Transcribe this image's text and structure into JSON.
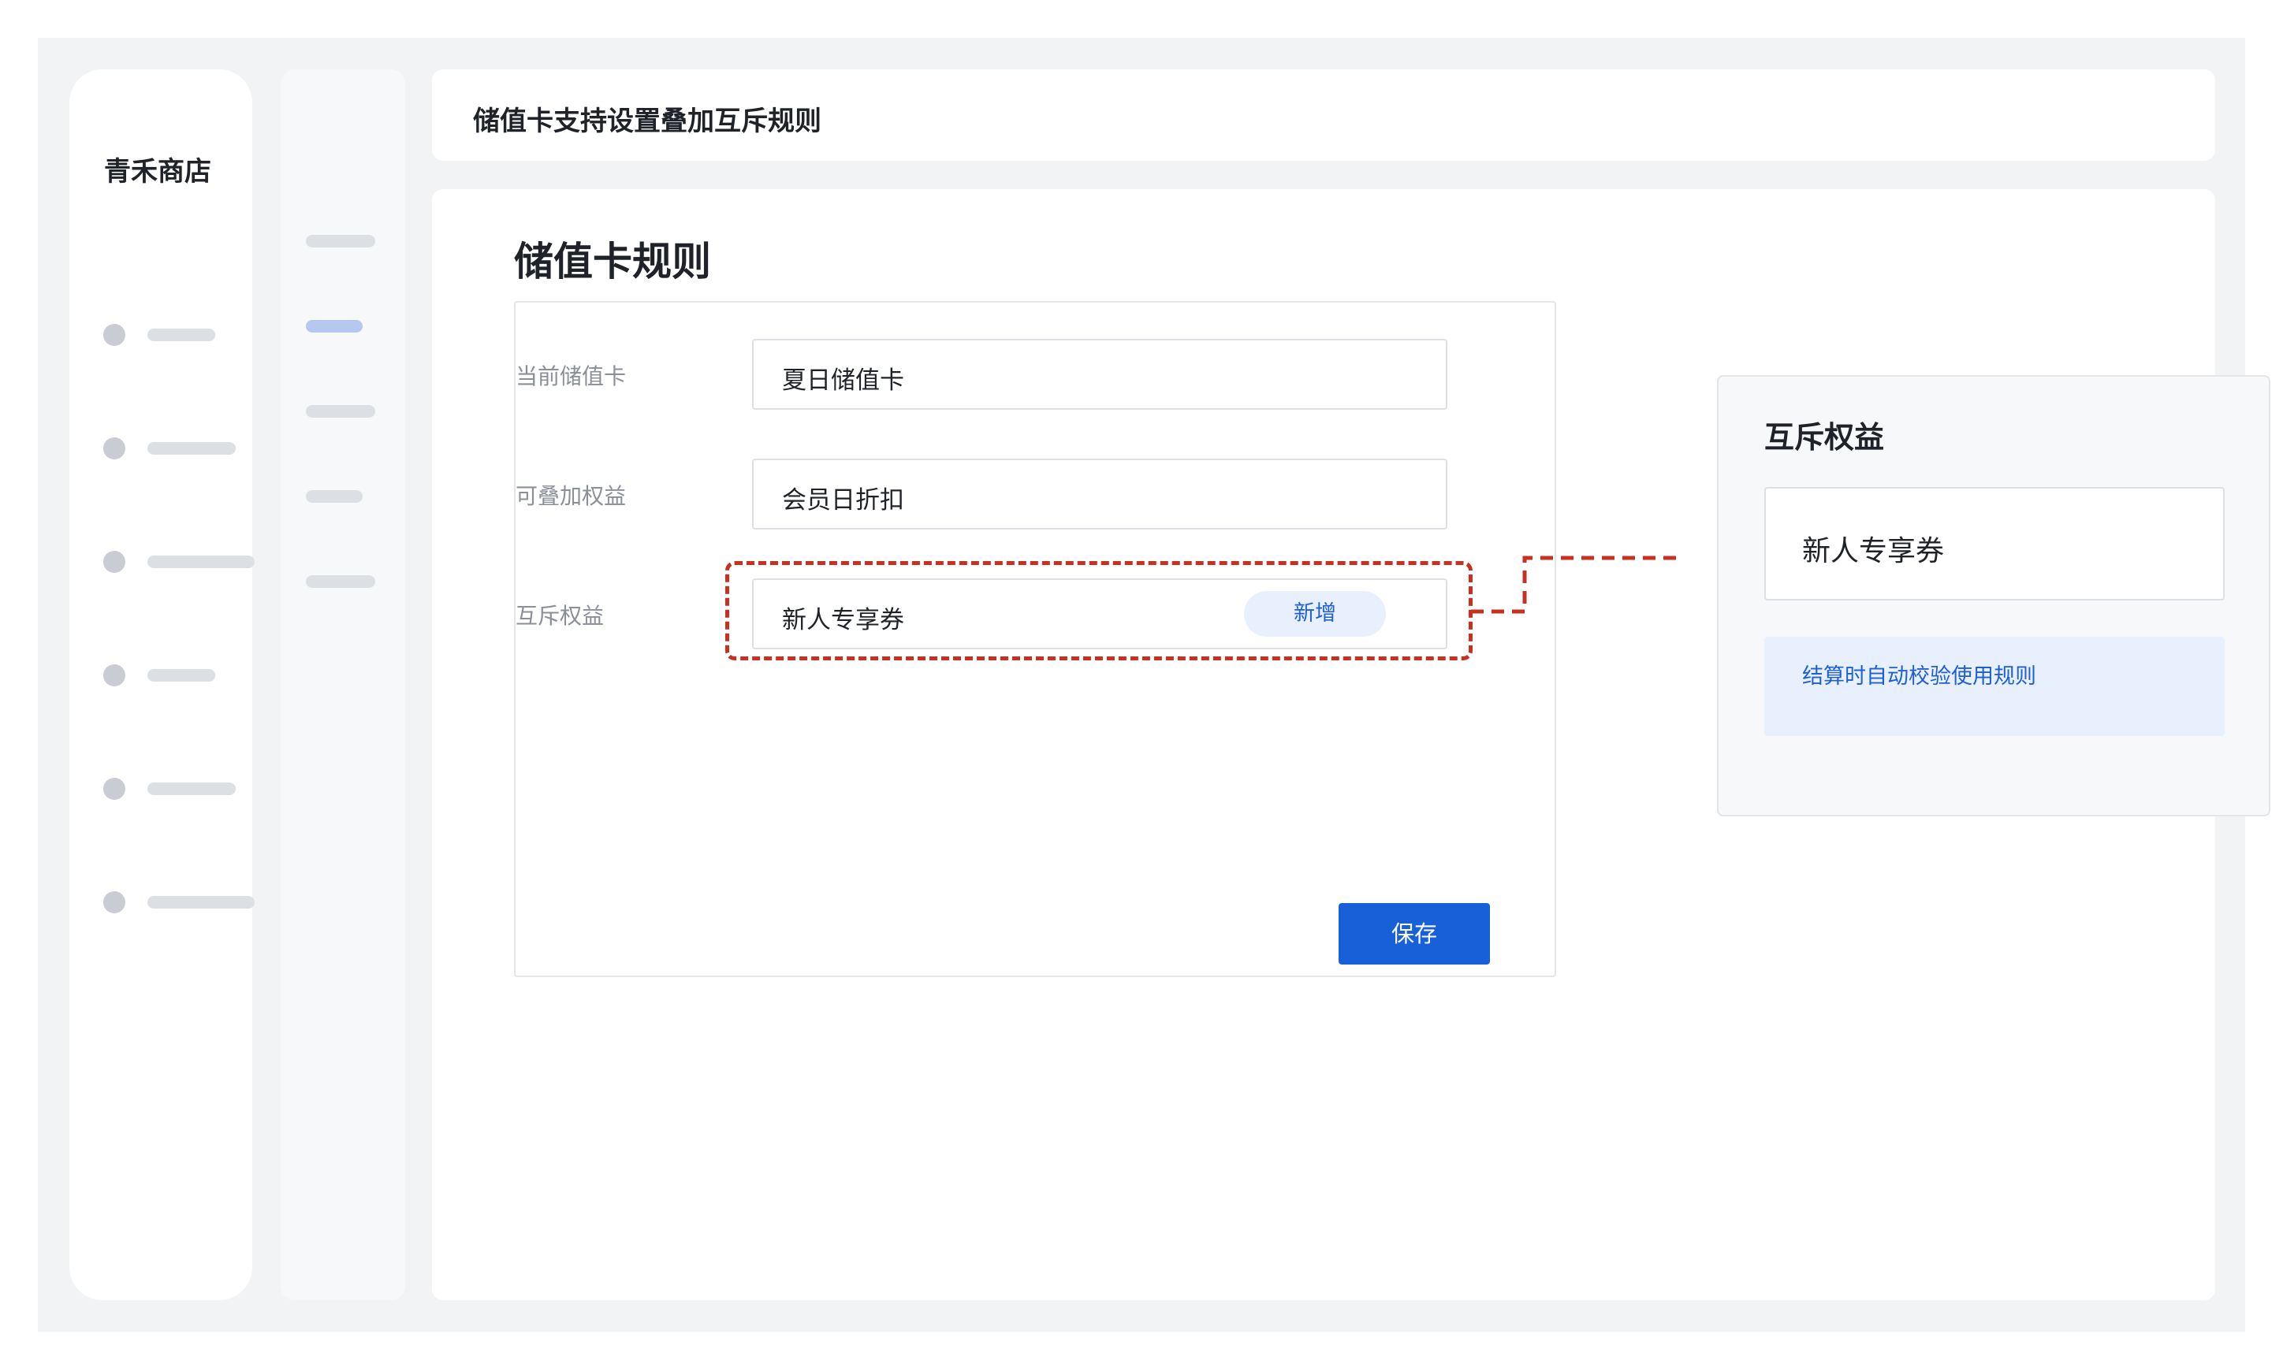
{
  "store": {
    "name": "青禾商店"
  },
  "header": {
    "title": "储值卡支持设置叠加互斥规则"
  },
  "page": {
    "title": "储值卡规则"
  },
  "form": {
    "current_card": {
      "label": "当前储值卡",
      "value": "夏日储值卡"
    },
    "stackable": {
      "label": "可叠加权益",
      "value": "会员日折扣"
    },
    "exclusive": {
      "label": "互斥权益",
      "value": "新人专享券",
      "tag": "新增"
    },
    "save_label": "保存"
  },
  "panel": {
    "title": "互斥权益",
    "item": "新人专享券",
    "note": "结算时自动校验使用规则"
  },
  "colors": {
    "accent": "#1760d8",
    "highlight": "#c8311f",
    "tag_bg": "#e8f0fd"
  }
}
